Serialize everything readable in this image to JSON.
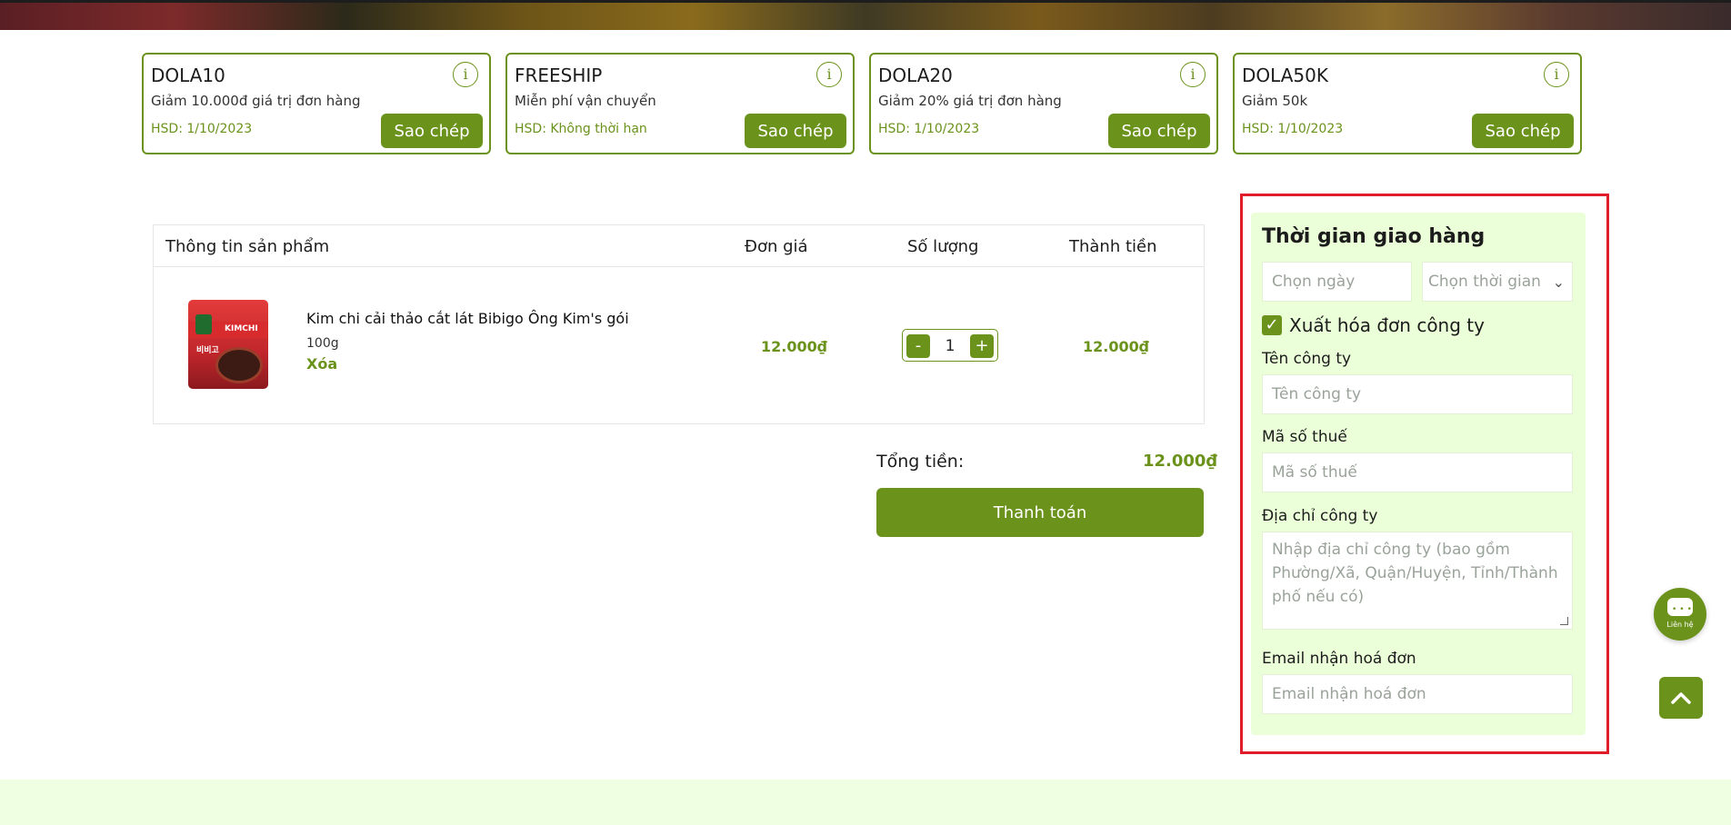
{
  "coupons": [
    {
      "code": "DOLA10",
      "desc": "Giảm 10.000đ giá trị đơn hàng",
      "expiry": "HSD: 1/10/2023",
      "copy_label": "Sao chép",
      "info_glyph": "i"
    },
    {
      "code": "FREESHIP",
      "desc": "Miễn phí vận chuyển",
      "expiry": "HSD: Không thời hạn",
      "copy_label": "Sao chép",
      "info_glyph": "i"
    },
    {
      "code": "DOLA20",
      "desc": "Giảm 20% giá trị đơn hàng",
      "expiry": "HSD: 1/10/2023",
      "copy_label": "Sao chép",
      "info_glyph": "i"
    },
    {
      "code": "DOLA50K",
      "desc": "Giảm 50k",
      "expiry": "HSD: 1/10/2023",
      "copy_label": "Sao chép",
      "info_glyph": "i"
    }
  ],
  "cart": {
    "headers": {
      "product": "Thông tin sản phẩm",
      "unit_price": "Đơn giá",
      "quantity": "Số lượng",
      "total": "Thành tiền"
    },
    "items": [
      {
        "name": "Kim chi cải thảo cắt lát Bibigo Ông Kim's gói",
        "variant": "100g",
        "remove_label": "Xóa",
        "unit_price": "12.000₫",
        "quantity": "1",
        "line_total": "12.000₫",
        "image_icon": "kimchi-package-image",
        "image_text": "KIMCHI",
        "image_text2": "비비고"
      }
    ],
    "qty_minus": "-",
    "qty_plus": "+"
  },
  "summary": {
    "total_label": "Tổng tiền:",
    "total_value": "12.000₫",
    "checkout_label": "Thanh toán"
  },
  "delivery": {
    "title": "Thời gian giao hàng",
    "date_placeholder": "Chọn ngày",
    "time_placeholder": "Chọn thời gian",
    "chevron": "⌄",
    "invoice_checked": true,
    "check_glyph": "✓",
    "invoice_label": "Xuất hóa đơn công ty",
    "company_name_label": "Tên công ty",
    "company_name_placeholder": "Tên công ty",
    "tax_code_label": "Mã số thuế",
    "tax_code_placeholder": "Mã số thuế",
    "company_address_label": "Địa chỉ công ty",
    "company_address_placeholder": "Nhập địa chỉ công ty (bao gồm Phường/Xã, Quận/Huyện, Tỉnh/Thành phố nếu có)",
    "email_label": "Email nhận hoá đơn",
    "email_placeholder": "Email nhận hoá đơn"
  },
  "floating": {
    "contact_label": "Liên hệ",
    "contact_dots": "•••",
    "back_to_top_icon": "chevron-up-icon",
    "chat_icon": "chat-bubble-icon"
  },
  "colors": {
    "accent": "#6b921b",
    "panel_bg": "#ebffd8",
    "highlight": "#e01e2b",
    "footer_bg": "#efffe1"
  }
}
